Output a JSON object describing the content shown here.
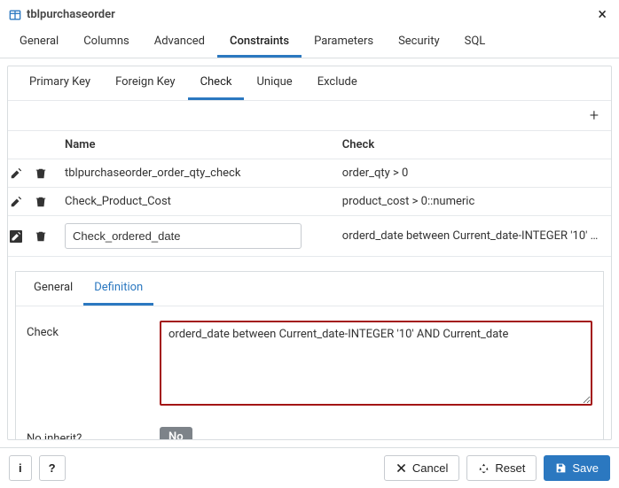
{
  "title": "tblpurchaseorder",
  "main_tabs": [
    "General",
    "Columns",
    "Advanced",
    "Constraints",
    "Parameters",
    "Security",
    "SQL"
  ],
  "main_tab_active": 3,
  "constraint_tabs": [
    "Primary Key",
    "Foreign Key",
    "Check",
    "Unique",
    "Exclude"
  ],
  "constraint_tab_active": 2,
  "grid": {
    "headers": {
      "name": "Name",
      "check": "Check"
    },
    "rows": [
      {
        "name": "tblpurchaseorder_order_qty_check",
        "check": "order_qty > 0",
        "editing": false
      },
      {
        "name": "Check_Product_Cost",
        "check": "product_cost > 0::numeric",
        "editing": false
      },
      {
        "name": "Check_ordered_date",
        "check": "orderd_date between Current_date-INTEGER '10' ...",
        "editing": true
      }
    ]
  },
  "detail_tabs": [
    "General",
    "Definition"
  ],
  "detail_tab_active": 1,
  "form": {
    "check_label": "Check",
    "check_value": "orderd_date between Current_date-INTEGER '10' AND Current_date",
    "no_inherit_label": "No inherit?",
    "no_inherit_value": "No"
  },
  "buttons": {
    "info": "i",
    "help": "?",
    "cancel": "Cancel",
    "reset": "Reset",
    "save": "Save"
  }
}
